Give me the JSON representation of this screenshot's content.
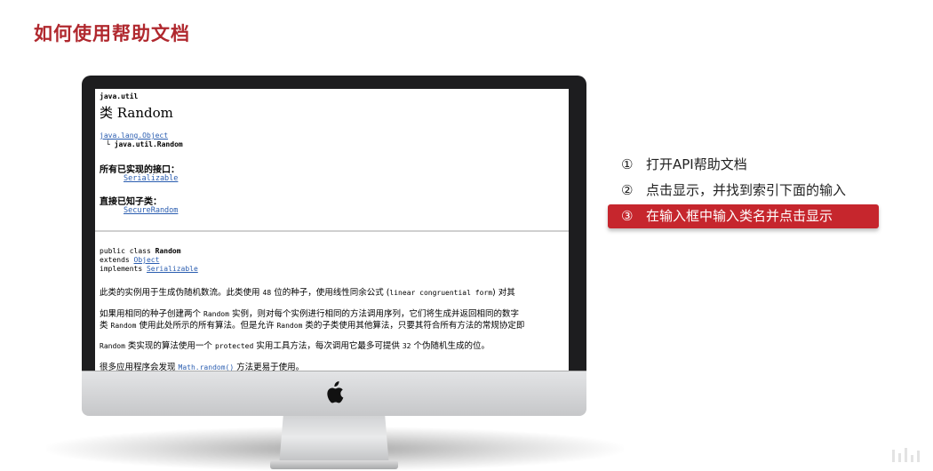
{
  "title": "如何使用帮助文档",
  "doc": {
    "package": "java.util",
    "class_title": "类 Random",
    "inherit_parent": "java.lang.Object",
    "inherit_child": "└ java.util.Random",
    "interfaces_heading": "所有已实现的接口：",
    "interfaces_value": "Serializable",
    "subclasses_heading": "直接已知子类：",
    "subclasses_value": "SecureRandom",
    "decl_line1_prefix": "public class ",
    "decl_line1_name": "Random",
    "decl_line2_prefix": "extends ",
    "decl_line2_link": "Object",
    "decl_line3_prefix": "implements ",
    "decl_line3_link": "Serializable",
    "para1_a": "此类的实例用于生成伪随机数流。此类使用 ",
    "para1_b": "48",
    "para1_c": " 位的种子，使用线性同余公式 (",
    "para1_d": "linear congruential form",
    "para1_e": ") 对其",
    "para2_line1_a": "如果用相同的种子创建两个 ",
    "para2_line1_b": "Random",
    "para2_line1_c": " 实例，则对每个实例进行相同的方法调用序列，它们将生成并返回相同的数字",
    "para2_line2_a": "类 ",
    "para2_line2_b": "Random",
    "para2_line2_c": " 使用此处所示的所有算法。但是允许 ",
    "para2_line2_d": "Random",
    "para2_line2_e": " 类的子类使用其他算法，只要其符合所有方法的常规协定即",
    "para3_a": "Random",
    "para3_b": " 类实现的算法使用一个 ",
    "para3_c": "protected",
    "para3_d": " 实用工具方法，每次调用它最多可提供 ",
    "para3_e": "32",
    "para3_f": " 个伪随机生成的位。",
    "para4_a": "很多应用程序会发现 ",
    "para4_b": "Math.random()",
    "para4_c": " 方法更易于使用。"
  },
  "steps": [
    {
      "num": "①",
      "text": "打开API帮助文档"
    },
    {
      "num": "②",
      "text": "点击显示，并找到索引下面的输入"
    },
    {
      "num": "③",
      "text": "在输入框中输入类名并点击显示"
    }
  ],
  "active_step": 3,
  "colors": {
    "accent": "#b0282e",
    "highlight": "#c6262d"
  }
}
